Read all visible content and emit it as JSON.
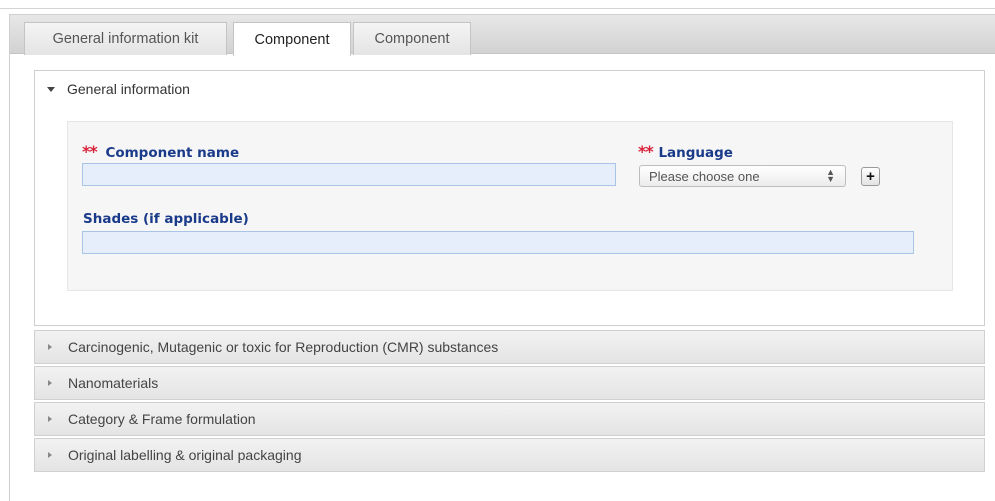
{
  "tabs": [
    {
      "label": "General information kit",
      "active": false
    },
    {
      "label": "Component",
      "active": true
    },
    {
      "label": "Component",
      "active": false
    }
  ],
  "general_section": {
    "title": "General information",
    "expanded": true,
    "required_marker": "**",
    "component_name_label": "Component name",
    "component_name_value": "",
    "language_label": "Language",
    "language_selected": "Please choose one",
    "add_button_label": "+",
    "shades_label": "Shades (if applicable)",
    "shades_value": ""
  },
  "collapsed_sections": [
    {
      "title": "Carcinogenic, Mutagenic or toxic for Reproduction (CMR) substances"
    },
    {
      "title": "Nanomaterials"
    },
    {
      "title": "Category & Frame formulation"
    },
    {
      "title": "Original labelling & original packaging"
    }
  ],
  "colors": {
    "label_blue": "#1a3a8a",
    "required_red": "#d9223a",
    "input_fill": "#e6eefb",
    "input_border": "#a8c4e6"
  }
}
